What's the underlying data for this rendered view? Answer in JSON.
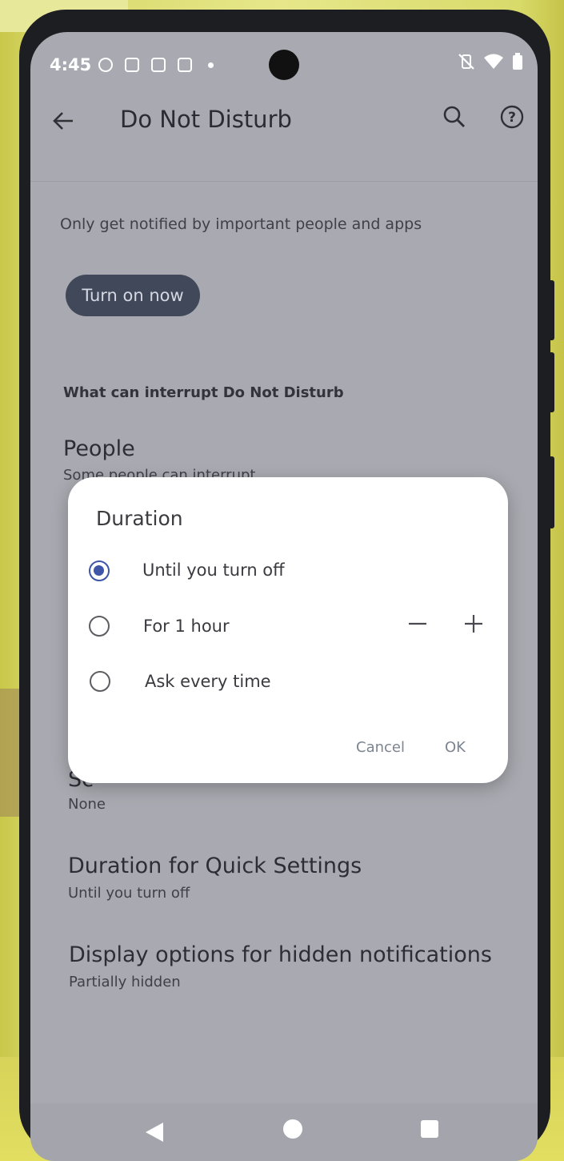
{
  "status_bar": {
    "time": "4:45"
  },
  "app_bar": {
    "title": "Do Not Disturb"
  },
  "main": {
    "description": "Only get notified by important people and apps",
    "turn_on_button": "Turn on now",
    "section_header": "What can interrupt Do Not Disturb",
    "items": [
      {
        "title": "People",
        "subtitle": "Some people can interrupt"
      },
      {
        "title": "Sc",
        "subtitle": "None"
      },
      {
        "title": "Duration for Quick Settings",
        "subtitle": "Until you turn off"
      },
      {
        "title": "Display options for hidden notifications",
        "subtitle": "Partially hidden"
      }
    ]
  },
  "dialog": {
    "title": "Duration",
    "options": [
      {
        "label": "Until you turn off",
        "selected": true
      },
      {
        "label": "For 1 hour",
        "selected": false
      },
      {
        "label": "Ask every time",
        "selected": false
      }
    ],
    "cancel_label": "Cancel",
    "ok_label": "OK"
  },
  "colors": {
    "accent": "#3f55a8",
    "scrim_background": "#a9aab1",
    "button_background": "#404859"
  }
}
